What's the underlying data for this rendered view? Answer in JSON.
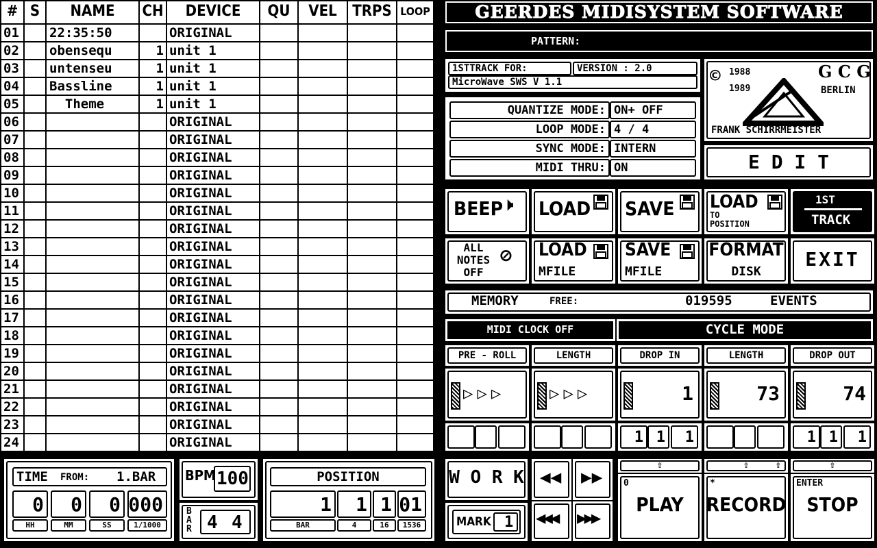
{
  "table": {
    "headers": [
      "#",
      "S",
      "NAME",
      "CH",
      "DEVICE",
      "QU",
      "VEL",
      "TRPS",
      "LOOP"
    ],
    "rows": [
      {
        "n": "01",
        "name": "22:35:50",
        "ch": "",
        "device": "ORIGINAL"
      },
      {
        "n": "02",
        "name": "obensequ",
        "ch": "1",
        "device": "unit 1"
      },
      {
        "n": "03",
        "name": "untenseu",
        "ch": "1",
        "device": "unit 1"
      },
      {
        "n": "04",
        "name": "Bassline",
        "ch": "1",
        "device": "unit 1"
      },
      {
        "n": "05",
        "name": "  Theme",
        "ch": "1",
        "device": "unit 1"
      },
      {
        "n": "06",
        "name": "",
        "ch": "",
        "device": "ORIGINAL"
      },
      {
        "n": "07",
        "name": "",
        "ch": "",
        "device": "ORIGINAL"
      },
      {
        "n": "08",
        "name": "",
        "ch": "",
        "device": "ORIGINAL"
      },
      {
        "n": "09",
        "name": "",
        "ch": "",
        "device": "ORIGINAL"
      },
      {
        "n": "10",
        "name": "",
        "ch": "",
        "device": "ORIGINAL"
      },
      {
        "n": "11",
        "name": "",
        "ch": "",
        "device": "ORIGINAL"
      },
      {
        "n": "12",
        "name": "",
        "ch": "",
        "device": "ORIGINAL"
      },
      {
        "n": "13",
        "name": "",
        "ch": "",
        "device": "ORIGINAL"
      },
      {
        "n": "14",
        "name": "",
        "ch": "",
        "device": "ORIGINAL"
      },
      {
        "n": "15",
        "name": "",
        "ch": "",
        "device": "ORIGINAL"
      },
      {
        "n": "16",
        "name": "",
        "ch": "",
        "device": "ORIGINAL"
      },
      {
        "n": "17",
        "name": "",
        "ch": "",
        "device": "ORIGINAL"
      },
      {
        "n": "18",
        "name": "",
        "ch": "",
        "device": "ORIGINAL"
      },
      {
        "n": "19",
        "name": "",
        "ch": "",
        "device": "ORIGINAL"
      },
      {
        "n": "20",
        "name": "",
        "ch": "",
        "device": "ORIGINAL"
      },
      {
        "n": "21",
        "name": "",
        "ch": "",
        "device": "ORIGINAL"
      },
      {
        "n": "22",
        "name": "",
        "ch": "",
        "device": "ORIGINAL"
      },
      {
        "n": "23",
        "name": "",
        "ch": "",
        "device": "ORIGINAL"
      },
      {
        "n": "24",
        "name": "",
        "ch": "",
        "device": "ORIGINAL"
      }
    ]
  },
  "title": "GEERDES MIDISYSTEM SOFTWARE",
  "pattern_label": "PATTERN:",
  "info": {
    "line1_a": "1STTRACK  FOR:",
    "line1_b": "VERSION : 2.0",
    "line2": "MicroWave SWS  V 1.1"
  },
  "modes": [
    {
      "label": "QUANTIZE MODE:",
      "value": "ON+ OFF"
    },
    {
      "label": "LOOP MODE:",
      "value": " 4 / 4"
    },
    {
      "label": "SYNC MODE:",
      "value": "INTERN"
    },
    {
      "label": "MIDI THRU:",
      "value": "ON"
    }
  ],
  "logo": {
    "copyright": "©",
    "years": "1988\n1989",
    "gcg": "G C G",
    "city": "BERLIN",
    "author": "FRANK SCHIRRMEISTER"
  },
  "edit_label": "E D I T",
  "buttons": {
    "beep": "BEEP",
    "load": "LOAD",
    "save": "SAVE",
    "load_to_pos_a": "LOAD",
    "load_to_pos_b": "TO\nPOSITION",
    "first_track_a": "1ST",
    "first_track_b": "TRACK",
    "all_notes": "ALL\nNOTES\nOFF",
    "load_mfile_a": "LOAD",
    "load_mfile_b": "MFILE",
    "save_mfile_a": "SAVE",
    "save_mfile_b": "MFILE",
    "format_a": "FORMAT",
    "format_b": "DISK",
    "exit": "EXIT"
  },
  "memory": {
    "label": "MEMORY",
    "free": "FREE:",
    "value": "019595",
    "unit": "EVENTS"
  },
  "midi_clock": "MIDI CLOCK OFF",
  "cycle_mode": "CYCLE MODE",
  "cycle_headers": [
    "PRE - ROLL",
    "LENGTH",
    "DROP IN",
    "LENGTH",
    "DROP OUT"
  ],
  "cycle_values": [
    "",
    "",
    "1",
    "73",
    "74"
  ],
  "cycle_sub": [
    [
      "",
      "",
      ""
    ],
    [
      "",
      "",
      ""
    ],
    [
      "1",
      "1",
      "1"
    ],
    [
      "",
      "",
      ""
    ],
    [
      "1",
      "1",
      "1"
    ]
  ],
  "time": {
    "label": "TIME",
    "from": "FROM:",
    "from_val": "1.BAR",
    "vals": [
      "0",
      "0",
      "0",
      "000"
    ],
    "units": [
      "HH",
      "MM",
      "SS",
      "1/1000"
    ]
  },
  "bpm": {
    "label": "BPM",
    "value": "100"
  },
  "bar": {
    "label": "BAR",
    "a": "4",
    "b": "4"
  },
  "position": {
    "label": "POSITION",
    "vals": [
      "1",
      "1",
      "1",
      "01"
    ],
    "units": [
      "BAR",
      "4",
      "16",
      "1536"
    ]
  },
  "work": "W O R K",
  "mark": {
    "label": "MARK",
    "value": "1"
  },
  "transport": {
    "play_hint": "0",
    "play": "PLAY",
    "record_hint": "*",
    "record": "RECORD",
    "stop_hint": "ENTER",
    "stop": "STOP"
  }
}
